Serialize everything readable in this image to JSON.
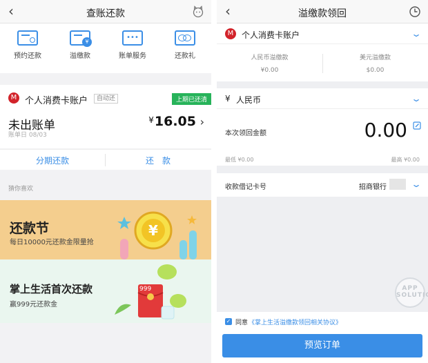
{
  "left": {
    "nav": {
      "back": "‹",
      "title": "查账还款"
    },
    "quick_actions": [
      {
        "label": "预约还款",
        "icon": "calendar-card-icon"
      },
      {
        "label": "溢缴款",
        "icon": "card-yen-icon"
      },
      {
        "label": "账单服务",
        "icon": "card-dots-icon"
      },
      {
        "label": "还款礼",
        "icon": "card-gift-icon"
      }
    ],
    "account": {
      "logo": "M",
      "name": "个人消费卡账户",
      "auto_tag": "自动还",
      "status_tag": "上期已还清",
      "unbilled_label": "未出账单",
      "bill_date": "账单日 08/03",
      "currency": "¥",
      "amount": "16.05",
      "chevron": "›"
    },
    "actions": {
      "installment": "分期还款",
      "repay": "还　款"
    },
    "guess_label": "猜你喜欢",
    "promo1": {
      "title": "还款节",
      "subtitle": "每日10000元还款金限量抢",
      "coin": "¥"
    },
    "promo2": {
      "title": "掌上生活首次还款",
      "subtitle": "赢999元还款金",
      "envelope_amount": "999"
    }
  },
  "right": {
    "nav": {
      "back": "‹",
      "title": "溢缴款领回"
    },
    "account": {
      "logo": "M",
      "name": "个人消费卡账户"
    },
    "balances": {
      "rmb_label": "人民币溢缴款",
      "rmb_value": "¥0.00",
      "usd_label": "美元溢缴款",
      "usd_value": "$0.00"
    },
    "currency": {
      "symbol": "¥",
      "name": "人民币"
    },
    "claim": {
      "label": "本次领回金额",
      "value": "0.00",
      "min": "最低 ¥0.00",
      "max": "最高 ¥0.00"
    },
    "bank": {
      "label": "收款借记卡号",
      "value": "招商银行"
    },
    "agreement": {
      "checkbox": "✓",
      "prefix": "同意",
      "link": "《掌上生活溢缴款领回相关协议》"
    },
    "button": "预览订单",
    "watermark": "APP SOLUTION"
  },
  "colors": {
    "accent": "#3a8ee6",
    "brand_red": "#d2232a",
    "success": "#27b35a",
    "promo_orange": "#f4ce8e",
    "promo_green": "#eaf6ef"
  }
}
